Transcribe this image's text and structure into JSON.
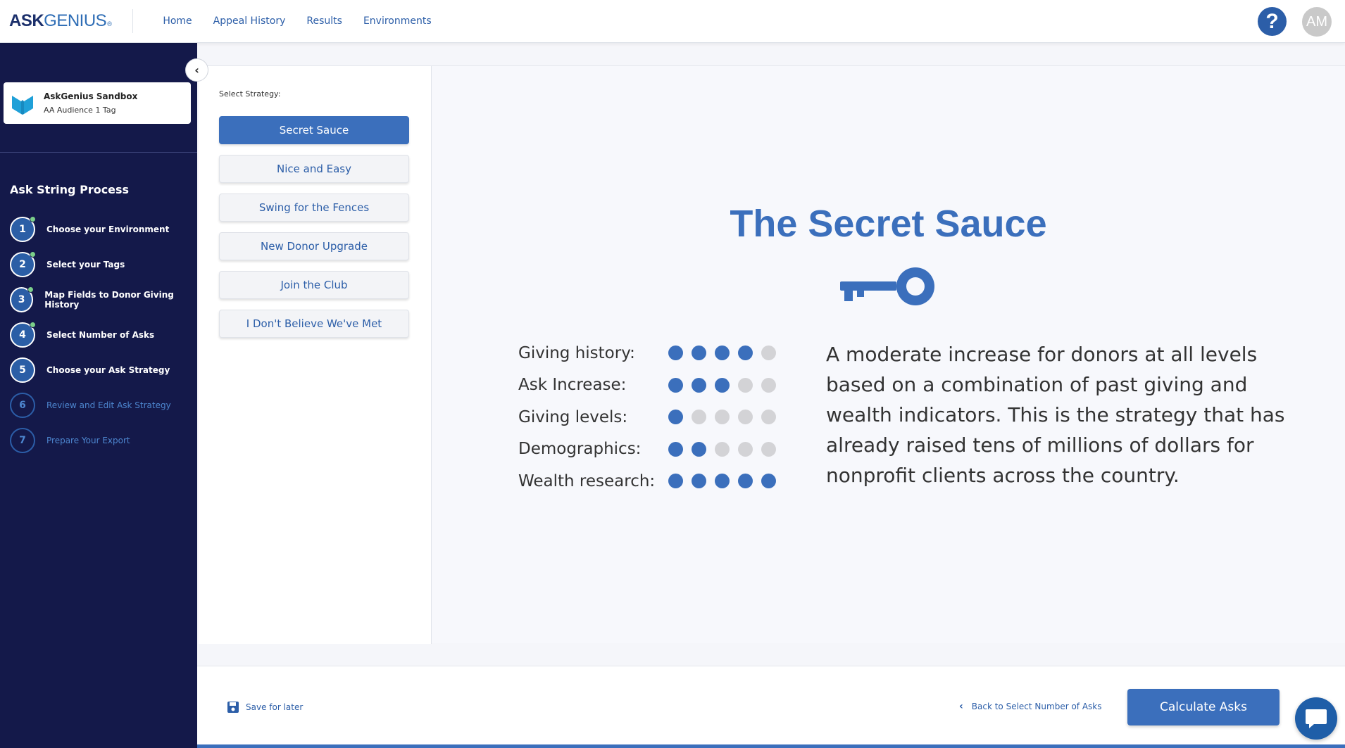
{
  "header": {
    "logo_bold": "ASK",
    "logo_light": "GENIUS",
    "logo_mark": "®",
    "nav": [
      "Home",
      "Appeal History",
      "Results",
      "Environments"
    ],
    "help_glyph": "?",
    "avatar_initials": "AM"
  },
  "sidebar": {
    "environment_name": "AskGenius Sandbox",
    "environment_tag": "AA Audience 1 Tag",
    "process_title": "Ask String Process",
    "steps": [
      {
        "number": "1",
        "label": "Choose your Environment",
        "complete": true
      },
      {
        "number": "2",
        "label": "Select your Tags",
        "complete": true
      },
      {
        "number": "3",
        "label": "Map Fields to Donor Giving History",
        "complete": true
      },
      {
        "number": "4",
        "label": "Select Number of Asks",
        "complete": true
      },
      {
        "number": "5",
        "label": "Choose your Ask Strategy",
        "complete": false,
        "current": true
      },
      {
        "number": "6",
        "label": "Review and Edit Ask Strategy",
        "complete": false
      },
      {
        "number": "7",
        "label": "Prepare Your Export",
        "complete": false
      }
    ]
  },
  "strategy": {
    "select_label": "Select Strategy:",
    "options": [
      "Secret Sauce",
      "Nice and Easy",
      "Swing for the Fences",
      "New Donor Upgrade",
      "Join the Club",
      "I Don't Believe We've Met"
    ],
    "selected_index": 0
  },
  "detail": {
    "title": "The Secret Sauce",
    "icon": "key-icon",
    "metrics": [
      {
        "label": "Giving history:",
        "rating": 4,
        "max": 5
      },
      {
        "label": "Ask Increase:",
        "rating": 3,
        "max": 5
      },
      {
        "label": "Giving levels:",
        "rating": 1,
        "max": 5
      },
      {
        "label": "Demographics:",
        "rating": 2,
        "max": 5
      },
      {
        "label": "Wealth research:",
        "rating": 5,
        "max": 5
      }
    ],
    "description": "A moderate increase for donors at all levels based on a combination of past giving and wealth indicators. This is the strategy that has already raised tens of millions of dollars for nonprofit clients across the country."
  },
  "footer": {
    "save_label": "Save for later",
    "back_label": "Back to Select Number of Asks",
    "calculate_label": "Calculate Asks"
  },
  "colors": {
    "primary": "#3b6fbc",
    "sidebar": "#14194a",
    "dot_off": "#d3d3d6",
    "complete": "#7bcf8a"
  }
}
